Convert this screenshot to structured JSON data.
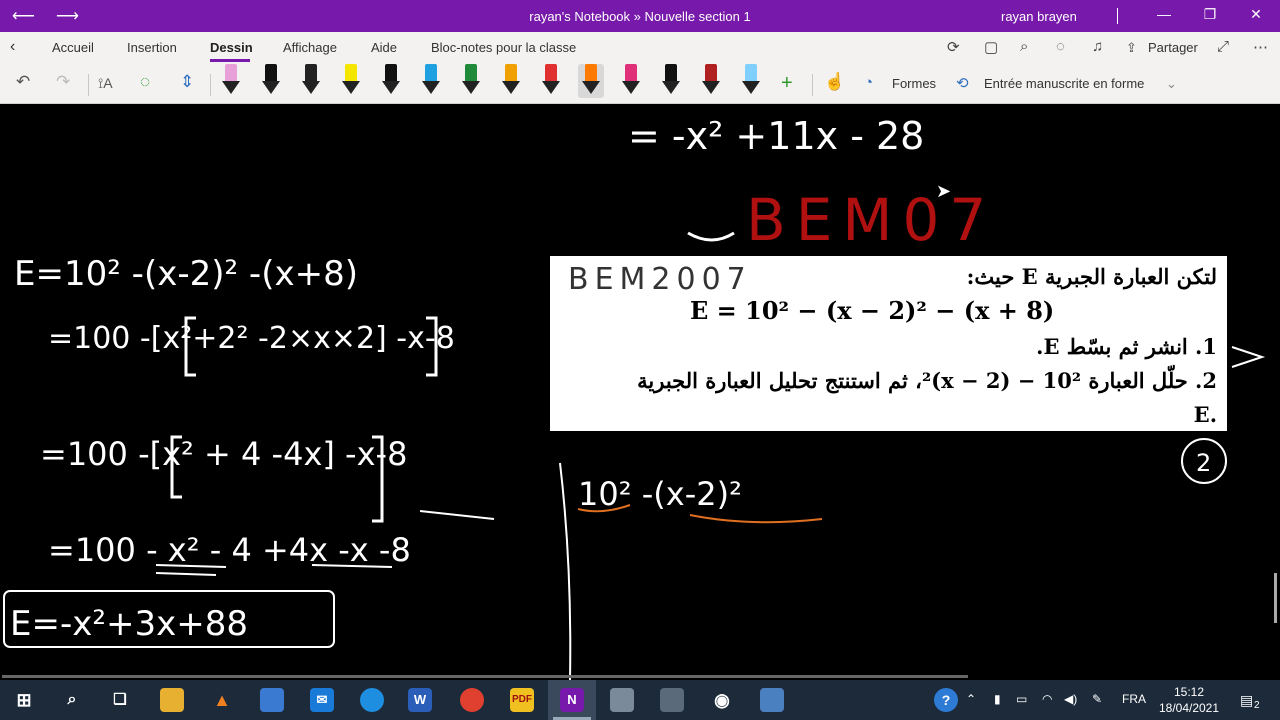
{
  "window": {
    "title": "rayan's Notebook » Nouvelle section 1",
    "user": "rayan brayen"
  },
  "ribbon": {
    "tabs": [
      "Accueil",
      "Insertion",
      "Dessin",
      "Affichage",
      "Aide",
      "Bloc-notes pour la classe"
    ],
    "active_tab": "Dessin",
    "share_label": "Partager",
    "shapes_label": "Formes",
    "ink_to_shape_label": "Entrée manuscrite en forme",
    "pen_colors": [
      "#e8a0d8",
      "#111111",
      "#222222",
      "#f5e600",
      "#111111",
      "#1fa0e0",
      "#1f8a3a",
      "#f0a000",
      "#e03030",
      "#ff7a00",
      "#e0307a",
      "#111111",
      "#b02020",
      "#80d0ff"
    ],
    "selected_pen_index": 9
  },
  "canvas": {
    "handwriting": {
      "top_line": "= -x² +11x - 28",
      "bem_red": "BEM07",
      "left_line1": "E=10² -(x-2)² -(x+8)",
      "left_line2": "=100 -[x²+2² -2×x×2] -x-8",
      "left_line3": "=100 -[x² + 4 -4x] -x-8",
      "left_line4": "=100 - x² - 4 +4x -x -8",
      "boxed_result": "E=-x²+3x+88",
      "right_work": "10² -(x-2)²",
      "circled": "2",
      "exercise_note": "BEM2007"
    },
    "exercise": {
      "line1": "لتكن العبارة الجبرية E حيث:",
      "equation": "E = 10² − (x − 2)² − (x + 8)",
      "q1": "1.  انشر ثم بسّط E.",
      "q2": "2.  حلّل العبارة 10² − (x − 2)²، ثم استنتج تحليل العبارة الجبرية",
      "q2_end": ".E"
    }
  },
  "taskbar": {
    "language": "FRA",
    "time": "15:12",
    "date": "18/04/2021",
    "notifications": "2"
  }
}
